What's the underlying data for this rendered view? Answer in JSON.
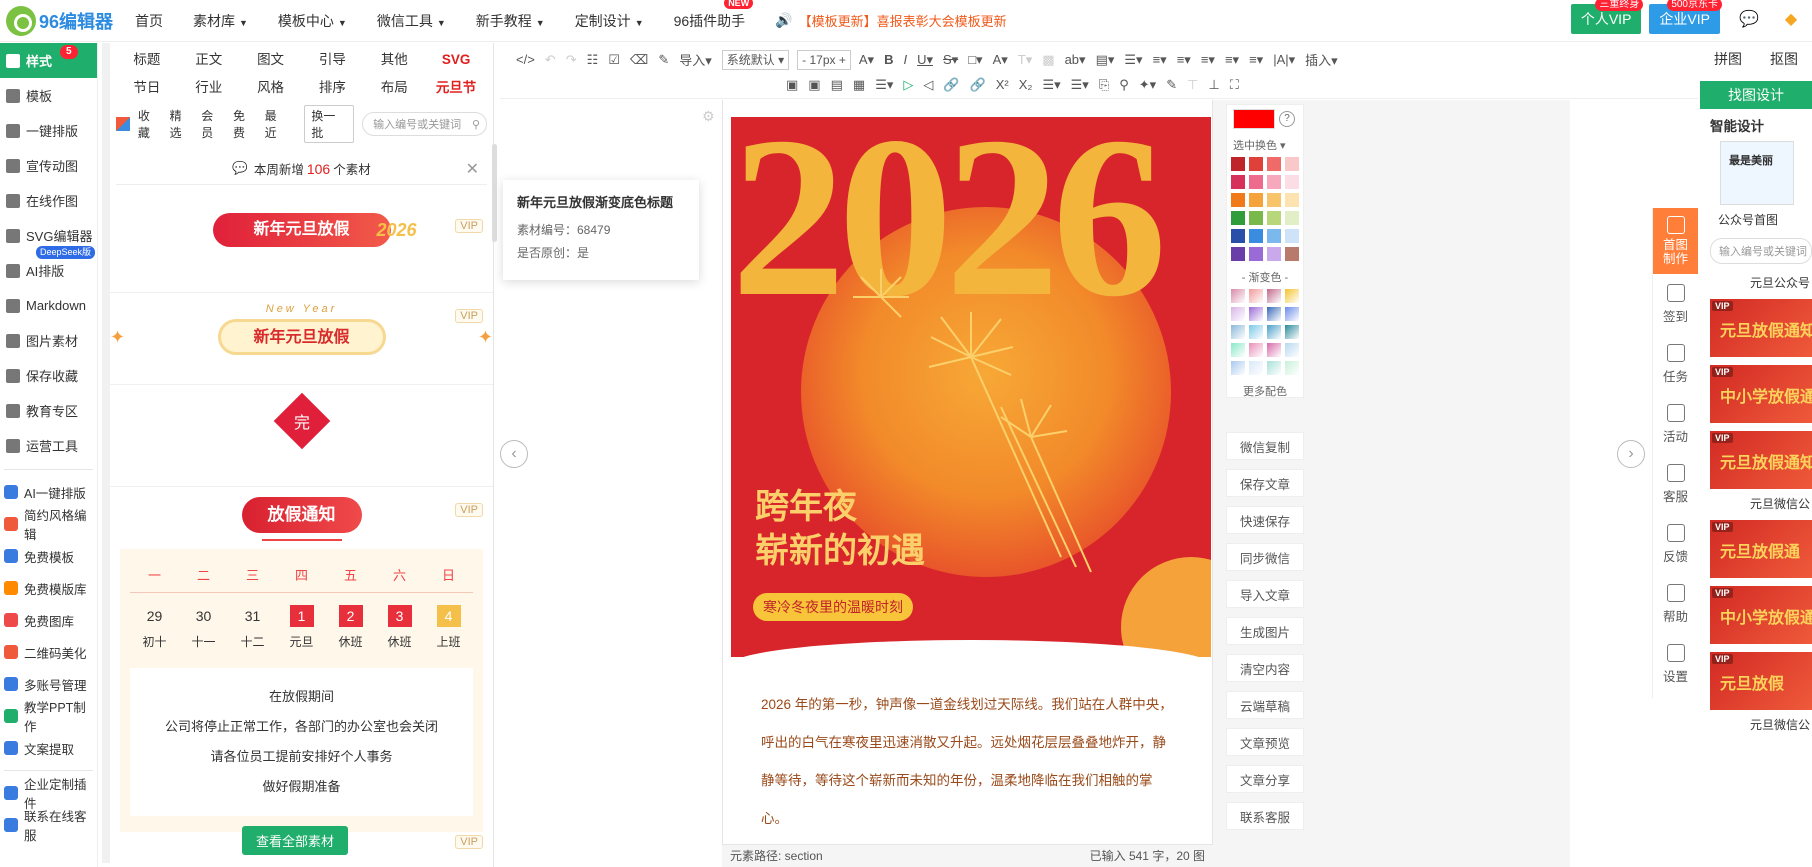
{
  "app": {
    "logo_text": "96编辑器"
  },
  "nav": {
    "items": [
      {
        "label": "首页",
        "caret": false
      },
      {
        "label": "素材库",
        "caret": true
      },
      {
        "label": "模板中心",
        "caret": true
      },
      {
        "label": "微信工具",
        "caret": true
      },
      {
        "label": "新手教程",
        "caret": true
      },
      {
        "label": "定制设计",
        "caret": true
      },
      {
        "label": "96插件助手",
        "caret": false,
        "badge": "NEW"
      }
    ],
    "notice": "【模板更新】喜报表彰大会模板更新"
  },
  "topright": {
    "personal_vip": "个人VIP",
    "personal_tag": "三重终身",
    "enterprise_vip": "企业VIP",
    "enterprise_tag": "500京东卡"
  },
  "leftnav": {
    "main": [
      {
        "label": "样式",
        "badge": "5",
        "active": true
      },
      {
        "label": "模板"
      },
      {
        "label": "一键排版"
      },
      {
        "label": "宣传动图"
      },
      {
        "label": "在线作图"
      },
      {
        "label": "SVG编辑器",
        "tag": "DeepSeek版"
      },
      {
        "label": "AI排版"
      },
      {
        "label": "Markdown"
      },
      {
        "label": "图片素材"
      },
      {
        "label": "保存收藏"
      },
      {
        "label": "教育专区"
      },
      {
        "label": "运营工具"
      }
    ],
    "tools": [
      {
        "label": "AI一键排版",
        "color": "#3a7be0"
      },
      {
        "label": "简约风格编辑",
        "color": "#ef5a3a"
      },
      {
        "label": "免费模板",
        "color": "#3a7be0"
      },
      {
        "label": "免费模版库",
        "color": "#ff8a00"
      },
      {
        "label": "免费图库",
        "color": "#ef4a4a"
      },
      {
        "label": "二维码美化",
        "color": "#ef5a3a"
      },
      {
        "label": "多账号管理",
        "color": "#3a7be0"
      },
      {
        "label": "教学PPT制作",
        "color": "#1fae6b"
      },
      {
        "label": "文案提取",
        "color": "#3a7be0"
      },
      {
        "label": "企业定制插件",
        "color": "#3a7be0"
      },
      {
        "label": "联系在线客服",
        "color": "#3a7be0"
      }
    ]
  },
  "material": {
    "categories": [
      "标题",
      "正文",
      "图文",
      "引导",
      "其他",
      "SVG",
      "节日",
      "行业",
      "风格",
      "排序",
      "布局",
      "元旦节"
    ],
    "filters": [
      "收藏",
      "精选",
      "会员",
      "免费",
      "最近"
    ],
    "swap": "换一批",
    "search_placeholder": "输入编号或关键词",
    "weekly_pre": "本周新增",
    "weekly_num": "106",
    "weekly_post": "个素材",
    "vip": "VIP",
    "item1_title": "新年元旦放假",
    "item1_year": "2026",
    "item2_sub": "New Year",
    "item2_title": "新年元旦放假",
    "item3_char": "完",
    "item4_title": "放假通知",
    "calendar": {
      "weekdays": [
        "一",
        "二",
        "三",
        "四",
        "五",
        "六",
        "日"
      ],
      "days": [
        "29",
        "30",
        "31",
        "1",
        "2",
        "3",
        "4"
      ],
      "labels": [
        "初十",
        "十一",
        "十二",
        "元旦",
        "休班",
        "休班",
        "上班"
      ],
      "lines": [
        "在放假期间",
        "公司将停止正常工作，各部门的办公室也会关闭",
        "请各位员工提前安排好个人事务",
        "做好假期准备"
      ]
    },
    "view_all": "查看全部素材"
  },
  "tooltip": {
    "title": "新年元旦放假渐变底色标题",
    "id_label": "素材编号：68479",
    "orig_label": "是否原创：是"
  },
  "toolbar": {
    "import": "导入",
    "font": "系统默认",
    "size": "17px",
    "insert": "插入"
  },
  "poster": {
    "year": "2026",
    "slogan_line1": "跨年夜",
    "slogan_line2": "崭新的初遇",
    "tagline": "寒冷冬夜里的温暖时刻",
    "article": "2026 年的第一秒，钟声像一道金线划过天际线。我们站在人群中央，呼出的白气在寒夜里迅速消散又升起。远处烟花层层叠叠地炸开，静静等待，等待这个崭新而未知的年份，温柔地降临在我们相触的掌心。"
  },
  "status": {
    "path": "元素路径:  section",
    "count": "已输入 541 字，20 图"
  },
  "palette": {
    "selected_label": "选中换色",
    "gradient_label": "- 渐变色 -",
    "more": "更多配色",
    "solid": [
      "#c0242b",
      "#e0403a",
      "#f06a6a",
      "#f9c9c9",
      "#d7305a",
      "#ef6b8e",
      "#f7a8bd",
      "#fbdde6",
      "#f07a1a",
      "#f5a33a",
      "#f8c46a",
      "#fde3b0",
      "#2f9e3a",
      "#79b84a",
      "#b7d77a",
      "#e2efc6",
      "#2a4fa8",
      "#3a8ce0",
      "#7ab8ee",
      "#cfe3f8",
      "#6a3ea8",
      "#9a6ad6",
      "#c9a8ec",
      "#b87a6a"
    ],
    "gradient": [
      "#d88aa8",
      "#f09a9a",
      "#c06a8a",
      "#f4c430",
      "#d8b4e8",
      "#9a6ad6",
      "#3a6ab8",
      "#6a8ae8",
      "#8ab8d8",
      "#7ac8e8",
      "#4aa0c8",
      "#2a8a9a",
      "#8ae8c8",
      "#e890b8",
      "#d86aa8",
      "#b8d8f0",
      "#a8c8f0",
      "#d8e8f8",
      "#a8e0d8",
      "#c8f0d8"
    ]
  },
  "actions": [
    "微信复制",
    "保存文章",
    "快速保存",
    "同步微信",
    "导入文章",
    "生成图片",
    "清空内容",
    "云端草稿",
    "文章预览",
    "文章分享",
    "联系客服"
  ],
  "rightnav": [
    {
      "label": "首图制作",
      "on": true
    },
    {
      "label": "签到"
    },
    {
      "label": "任务"
    },
    {
      "label": "活动"
    },
    {
      "label": "客服"
    },
    {
      "label": "反馈"
    },
    {
      "label": "帮助"
    },
    {
      "label": "设置"
    }
  ],
  "rightpanel": {
    "tab1": "拼图",
    "tab2": "抠图",
    "find_design": "找图设计",
    "smart": "智能设计",
    "thumb_text": "最是美丽",
    "thumb_caption": "公众号首图",
    "search_placeholder": "输入编号或关键词",
    "sec1": "元旦公众号",
    "sec2": "元旦微信公",
    "sec3": "元旦微信公",
    "thumbs": [
      "元旦放假通知",
      "中小学放假通知",
      "元旦放假通知",
      "元旦放假通",
      "中小学放假通知",
      "元旦放假"
    ],
    "vip": "VIP"
  }
}
